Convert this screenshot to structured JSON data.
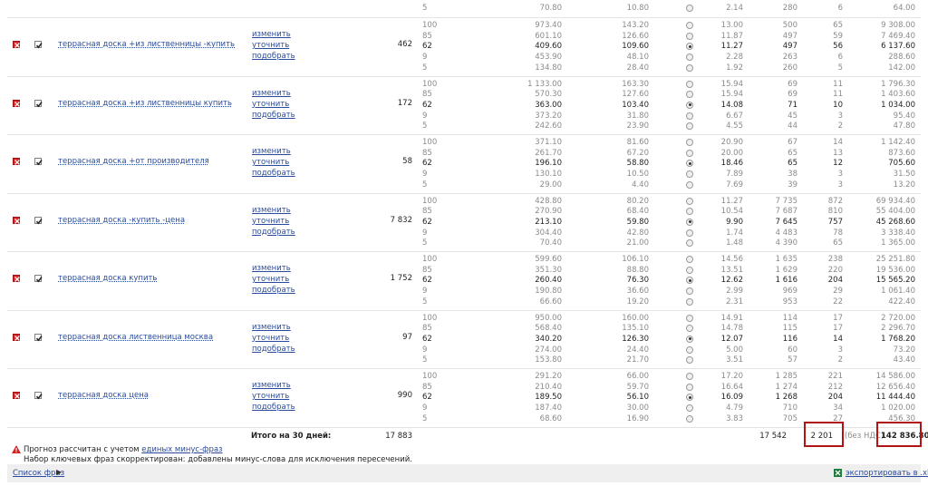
{
  "top_partial": {
    "position": "5",
    "bid": "70.80",
    "price": "10.80",
    "ctr": "2.14",
    "impressions": "280",
    "clicks": "6",
    "cost": "64.00"
  },
  "actions": {
    "change": "изменить",
    "refine": "уточнить",
    "pick": "подобрать"
  },
  "keywords": [
    {
      "phrase": "террасная доска +из лиственницы -купить",
      "volume": "462",
      "rows": [
        {
          "position": "100",
          "bid": "973.40",
          "price": "143.20",
          "ctr": "13.00",
          "impressions": "500",
          "clicks": "65",
          "cost": "9 308.00",
          "selected": false
        },
        {
          "position": "85",
          "bid": "601.10",
          "price": "126.60",
          "ctr": "11.87",
          "impressions": "497",
          "clicks": "59",
          "cost": "7 469.40",
          "selected": false
        },
        {
          "position": "62",
          "bid": "409.60",
          "price": "109.60",
          "ctr": "11.27",
          "impressions": "497",
          "clicks": "56",
          "cost": "6 137.60",
          "selected": true
        },
        {
          "position": "9",
          "bid": "453.90",
          "price": "48.10",
          "ctr": "2.28",
          "impressions": "263",
          "clicks": "6",
          "cost": "288.60",
          "selected": false
        },
        {
          "position": "5",
          "bid": "134.80",
          "price": "28.40",
          "ctr": "1.92",
          "impressions": "260",
          "clicks": "5",
          "cost": "142.00",
          "selected": false
        }
      ]
    },
    {
      "phrase": "террасная доска +из лиственницы купить",
      "volume": "172",
      "rows": [
        {
          "position": "100",
          "bid": "1 133.00",
          "price": "163.30",
          "ctr": "15.94",
          "impressions": "69",
          "clicks": "11",
          "cost": "1 796.30",
          "selected": false
        },
        {
          "position": "85",
          "bid": "570.30",
          "price": "127.60",
          "ctr": "15.94",
          "impressions": "69",
          "clicks": "11",
          "cost": "1 403.60",
          "selected": false
        },
        {
          "position": "62",
          "bid": "363.00",
          "price": "103.40",
          "ctr": "14.08",
          "impressions": "71",
          "clicks": "10",
          "cost": "1 034.00",
          "selected": true
        },
        {
          "position": "9",
          "bid": "373.20",
          "price": "31.80",
          "ctr": "6.67",
          "impressions": "45",
          "clicks": "3",
          "cost": "95.40",
          "selected": false
        },
        {
          "position": "5",
          "bid": "242.60",
          "price": "23.90",
          "ctr": "4.55",
          "impressions": "44",
          "clicks": "2",
          "cost": "47.80",
          "selected": false
        }
      ]
    },
    {
      "phrase": "террасная доска +от производителя",
      "volume": "58",
      "rows": [
        {
          "position": "100",
          "bid": "371.10",
          "price": "81.60",
          "ctr": "20.90",
          "impressions": "67",
          "clicks": "14",
          "cost": "1 142.40",
          "selected": false
        },
        {
          "position": "85",
          "bid": "261.70",
          "price": "67.20",
          "ctr": "20.00",
          "impressions": "65",
          "clicks": "13",
          "cost": "873.60",
          "selected": false
        },
        {
          "position": "62",
          "bid": "196.10",
          "price": "58.80",
          "ctr": "18.46",
          "impressions": "65",
          "clicks": "12",
          "cost": "705.60",
          "selected": true
        },
        {
          "position": "9",
          "bid": "130.10",
          "price": "10.50",
          "ctr": "7.89",
          "impressions": "38",
          "clicks": "3",
          "cost": "31.50",
          "selected": false
        },
        {
          "position": "5",
          "bid": "29.00",
          "price": "4.40",
          "ctr": "7.69",
          "impressions": "39",
          "clicks": "3",
          "cost": "13.20",
          "selected": false
        }
      ]
    },
    {
      "phrase": "террасная доска -купить -цена",
      "volume": "7 832",
      "rows": [
        {
          "position": "100",
          "bid": "428.80",
          "price": "80.20",
          "ctr": "11.27",
          "impressions": "7 735",
          "clicks": "872",
          "cost": "69 934.40",
          "selected": false
        },
        {
          "position": "85",
          "bid": "270.90",
          "price": "68.40",
          "ctr": "10.54",
          "impressions": "7 687",
          "clicks": "810",
          "cost": "55 404.00",
          "selected": false
        },
        {
          "position": "62",
          "bid": "213.10",
          "price": "59.80",
          "ctr": "9.90",
          "impressions": "7 645",
          "clicks": "757",
          "cost": "45 268.60",
          "selected": true
        },
        {
          "position": "9",
          "bid": "304.40",
          "price": "42.80",
          "ctr": "1.74",
          "impressions": "4 483",
          "clicks": "78",
          "cost": "3 338.40",
          "selected": false
        },
        {
          "position": "5",
          "bid": "70.40",
          "price": "21.00",
          "ctr": "1.48",
          "impressions": "4 390",
          "clicks": "65",
          "cost": "1 365.00",
          "selected": false
        }
      ]
    },
    {
      "phrase": "террасная доска купить",
      "volume": "1 752",
      "rows": [
        {
          "position": "100",
          "bid": "599.60",
          "price": "106.10",
          "ctr": "14.56",
          "impressions": "1 635",
          "clicks": "238",
          "cost": "25 251.80",
          "selected": false
        },
        {
          "position": "85",
          "bid": "351.30",
          "price": "88.80",
          "ctr": "13.51",
          "impressions": "1 629",
          "clicks": "220",
          "cost": "19 536.00",
          "selected": false
        },
        {
          "position": "62",
          "bid": "260.40",
          "price": "76.30",
          "ctr": "12.62",
          "impressions": "1 616",
          "clicks": "204",
          "cost": "15 565.20",
          "selected": true
        },
        {
          "position": "9",
          "bid": "190.80",
          "price": "36.60",
          "ctr": "2.99",
          "impressions": "969",
          "clicks": "29",
          "cost": "1 061.40",
          "selected": false
        },
        {
          "position": "5",
          "bid": "66.60",
          "price": "19.20",
          "ctr": "2.31",
          "impressions": "953",
          "clicks": "22",
          "cost": "422.40",
          "selected": false
        }
      ]
    },
    {
      "phrase": "террасная доска лиственница москва",
      "volume": "97",
      "rows": [
        {
          "position": "100",
          "bid": "950.00",
          "price": "160.00",
          "ctr": "14.91",
          "impressions": "114",
          "clicks": "17",
          "cost": "2 720.00",
          "selected": false
        },
        {
          "position": "85",
          "bid": "568.40",
          "price": "135.10",
          "ctr": "14.78",
          "impressions": "115",
          "clicks": "17",
          "cost": "2 296.70",
          "selected": false
        },
        {
          "position": "62",
          "bid": "340.20",
          "price": "126.30",
          "ctr": "12.07",
          "impressions": "116",
          "clicks": "14",
          "cost": "1 768.20",
          "selected": true
        },
        {
          "position": "9",
          "bid": "274.00",
          "price": "24.40",
          "ctr": "5.00",
          "impressions": "60",
          "clicks": "3",
          "cost": "73.20",
          "selected": false
        },
        {
          "position": "5",
          "bid": "153.80",
          "price": "21.70",
          "ctr": "3.51",
          "impressions": "57",
          "clicks": "2",
          "cost": "43.40",
          "selected": false
        }
      ]
    },
    {
      "phrase": "террасная доска цена",
      "volume": "990",
      "rows": [
        {
          "position": "100",
          "bid": "291.20",
          "price": "66.00",
          "ctr": "17.20",
          "impressions": "1 285",
          "clicks": "221",
          "cost": "14 586.00",
          "selected": false
        },
        {
          "position": "85",
          "bid": "210.40",
          "price": "59.70",
          "ctr": "16.64",
          "impressions": "1 274",
          "clicks": "212",
          "cost": "12 656.40",
          "selected": false
        },
        {
          "position": "62",
          "bid": "189.50",
          "price": "56.10",
          "ctr": "16.09",
          "impressions": "1 268",
          "clicks": "204",
          "cost": "11 444.40",
          "selected": true
        },
        {
          "position": "9",
          "bid": "187.40",
          "price": "30.00",
          "ctr": "4.79",
          "impressions": "710",
          "clicks": "34",
          "cost": "1 020.00",
          "selected": false
        },
        {
          "position": "5",
          "bid": "68.60",
          "price": "16.90",
          "ctr": "3.83",
          "impressions": "705",
          "clicks": "27",
          "cost": "456.30",
          "selected": false
        }
      ]
    }
  ],
  "totals": {
    "label": "Итого на 30 дней:",
    "volume": "17 883",
    "impressions": "17 542",
    "clicks": "2 201",
    "vat_note": "(без НДС)",
    "cost": "142 836.80"
  },
  "notes": {
    "forecast_prefix": "Прогноз рассчитан с учетом",
    "forecast_link": "единых минус-фраз",
    "second": "Набор ключевых фраз скорректирован: добавлены минус-слова для исключения пересечений."
  },
  "footer": {
    "phrase_list": "Список фраз",
    "export": "экспортировать в .xls"
  },
  "colors": {
    "highlight": "#b01414",
    "link": "#2a4b9b"
  }
}
